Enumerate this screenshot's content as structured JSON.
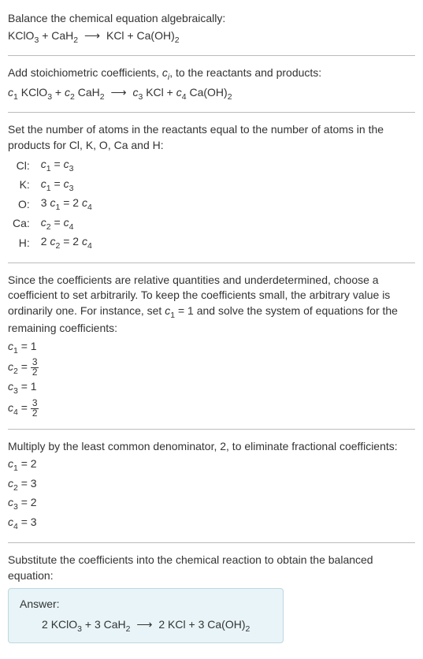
{
  "intro": {
    "title": "Balance the chemical equation algebraically:",
    "eq_parts": {
      "r1": "KClO",
      "r1_sub": "3",
      "r2": "CaH",
      "r2_sub": "2",
      "arrow": "⟶",
      "p1": "KCl",
      "p2": "Ca(OH)",
      "p2_sub": "2"
    }
  },
  "stoich": {
    "text_a": "Add stoichiometric coefficients, ",
    "text_b": ", to the reactants and products:",
    "c1": "c",
    "c1_sub": "1",
    "c2": "c",
    "c2_sub": "2",
    "c3": "c",
    "c3_sub": "3",
    "c4": "c",
    "c4_sub": "4"
  },
  "atoms": {
    "intro": "Set the number of atoms in the reactants equal to the number of atoms in the products for Cl, K, O, Ca and H:",
    "rows": [
      {
        "el": "Cl:",
        "lhs_c": "c",
        "lhs_s": "1",
        "eq": " = ",
        "rhs_c": "c",
        "rhs_s": "3",
        "mult_l": "",
        "mult_r": ""
      },
      {
        "el": "K:",
        "lhs_c": "c",
        "lhs_s": "1",
        "eq": " = ",
        "rhs_c": "c",
        "rhs_s": "3",
        "mult_l": "",
        "mult_r": ""
      },
      {
        "el": "O:",
        "lhs_c": "c",
        "lhs_s": "1",
        "eq": " = ",
        "rhs_c": "c",
        "rhs_s": "4",
        "mult_l": "3 ",
        "mult_r": "2 "
      },
      {
        "el": "Ca:",
        "lhs_c": "c",
        "lhs_s": "2",
        "eq": " = ",
        "rhs_c": "c",
        "rhs_s": "4",
        "mult_l": "",
        "mult_r": ""
      },
      {
        "el": "H:",
        "lhs_c": "c",
        "lhs_s": "2",
        "eq": " = ",
        "rhs_c": "c",
        "rhs_s": "4",
        "mult_l": "2 ",
        "mult_r": "2 "
      }
    ]
  },
  "solve": {
    "text_a": "Since the coefficients are relative quantities and underdetermined, choose a coefficient to set arbitrarily. To keep the coefficients small, the arbitrary value is ordinarily one. For instance, set ",
    "text_b": " = 1 and solve the system of equations for the remaining coefficients:",
    "c1_label": "c",
    "c1_sub": "1",
    "c1_eq": " = 1",
    "c2_label": "c",
    "c2_sub": "2",
    "c2_eq": " = ",
    "c3_label": "c",
    "c3_sub": "3",
    "c3_eq": " = 1",
    "c4_label": "c",
    "c4_sub": "4",
    "c4_eq": " = ",
    "frac_num": "3",
    "frac_den": "2"
  },
  "mult": {
    "text": "Multiply by the least common denominator, 2, to eliminate fractional coefficients:",
    "c1_label": "c",
    "c1_sub": "1",
    "c1_eq": " = 2",
    "c2_label": "c",
    "c2_sub": "2",
    "c2_eq": " = 3",
    "c3_label": "c",
    "c3_sub": "3",
    "c3_eq": " = 2",
    "c4_label": "c",
    "c4_sub": "4",
    "c4_eq": " = 3"
  },
  "final": {
    "text": "Substitute the coefficients into the chemical reaction to obtain the balanced equation:",
    "answer_label": "Answer:",
    "n1": "2 ",
    "n2": "3 ",
    "n3": "2 ",
    "n4": "3 "
  },
  "ci_var": "c",
  "ci_sub": "i"
}
